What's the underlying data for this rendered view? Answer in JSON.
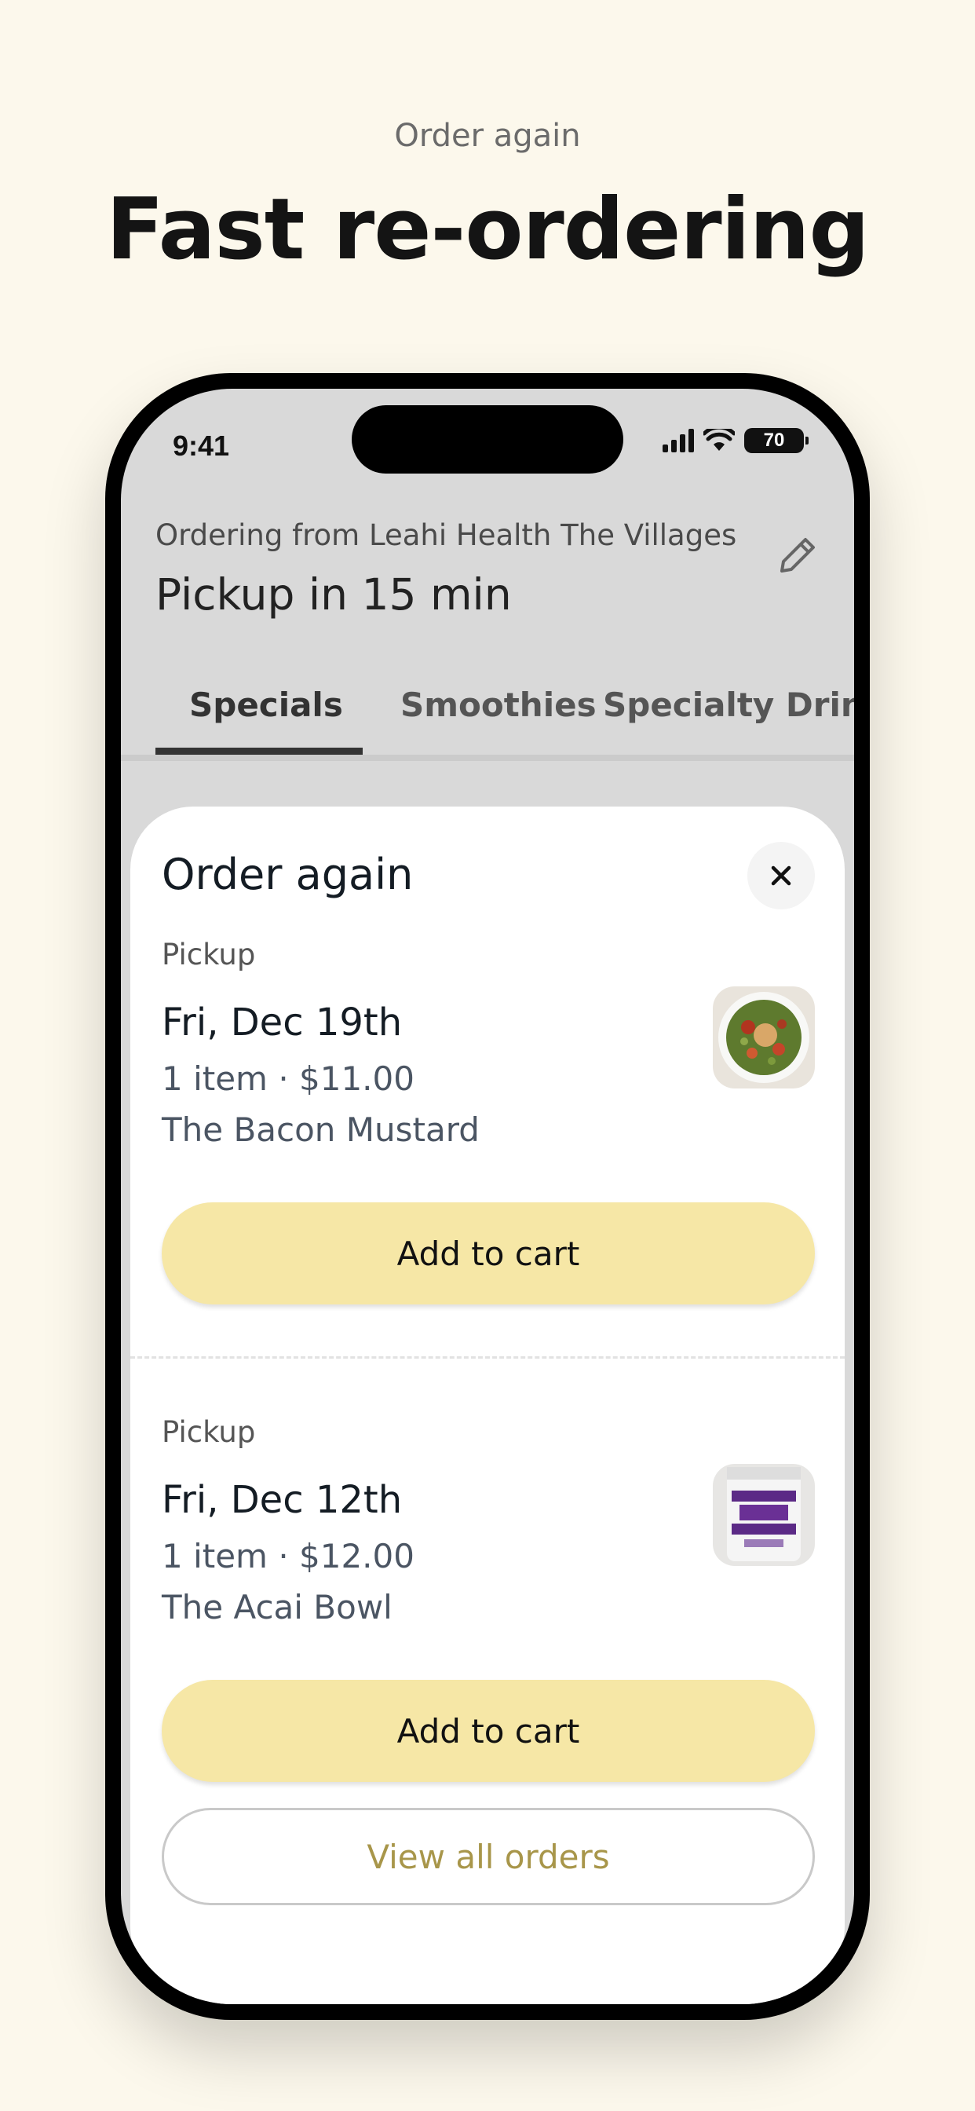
{
  "promo": {
    "eyebrow": "Order again",
    "headline": "Fast re-ordering"
  },
  "status_bar": {
    "time": "9:41",
    "battery": "70"
  },
  "header": {
    "ordering_from": "Ordering from Leahi Health The Villages",
    "pickup_time": "Pickup in 15 min"
  },
  "tabs": [
    {
      "label": "Specials",
      "active": true
    },
    {
      "label": "Smoothies",
      "active": false
    },
    {
      "label": "Specialty Drinks",
      "active": false
    }
  ],
  "sheet": {
    "title": "Order again",
    "orders": [
      {
        "method": "Pickup",
        "date": "Fri, Dec 19th",
        "summary": "1 item · $11.00",
        "item_name": "The Bacon Mustard",
        "thumbnail": "salad-bowl-photo",
        "button": "Add to cart"
      },
      {
        "method": "Pickup",
        "date": "Fri, Dec 12th",
        "summary": "1 item · $12.00",
        "item_name": "The Acai Bowl",
        "thumbnail": "acai-sorbet-tub-photo",
        "button": "Add to cart"
      }
    ],
    "view_all": "View all orders"
  },
  "colors": {
    "background": "#fcf8ec",
    "add_button": "#f6e7a6",
    "view_all_text": "#a8964a"
  }
}
